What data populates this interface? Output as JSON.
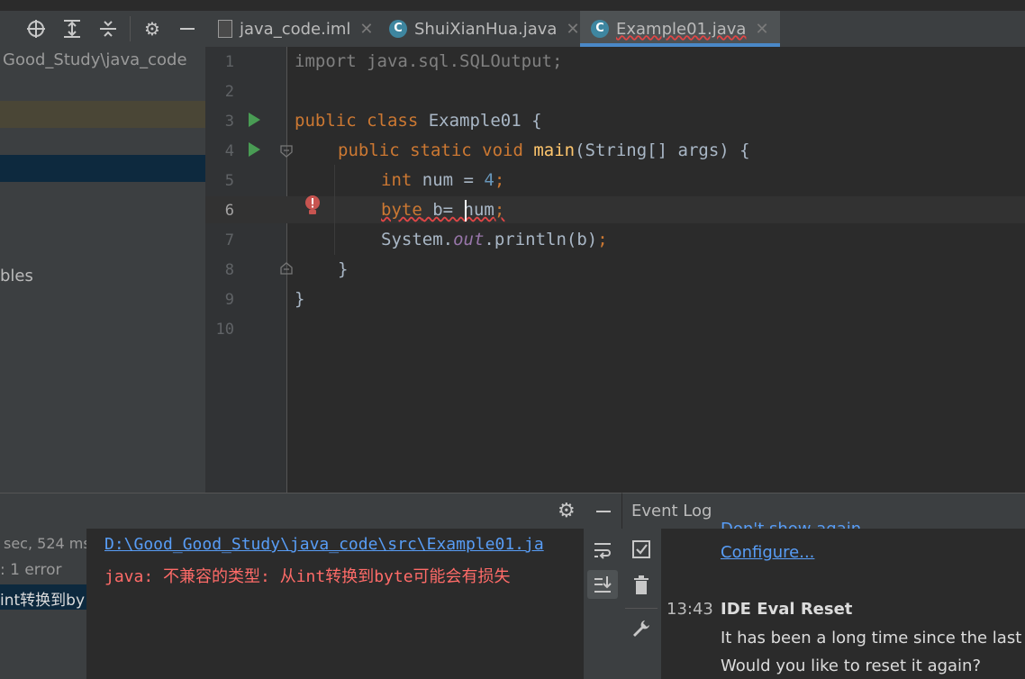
{
  "project_panel": {
    "path_fragment": "Good_Study\\java_code",
    "item_fragment": "bles"
  },
  "tabs": [
    {
      "label": "java_code.iml"
    },
    {
      "label": "ShuiXianHua.java"
    },
    {
      "label": "Example01.java"
    }
  ],
  "editor": {
    "line_numbers": [
      "1",
      "2",
      "3",
      "4",
      "5",
      "6",
      "7",
      "8",
      "9",
      "10"
    ],
    "lines": {
      "l1": "import java.sql.SQLOutput;",
      "l3_kw": "public class ",
      "l3_name": "Example01 {",
      "l4_kw": "public static void ",
      "l4_fn": "main",
      "l4_rest": "(String[] args) {",
      "l5_kw": "int",
      "l5_var": " num = ",
      "l5_num": "4",
      "l5_semi": ";",
      "l6_kw": "byte",
      "l6_rest": " b= num",
      "l6_semi": ";",
      "l7_a": "System.",
      "l7_out": "out",
      "l7_b": ".println(b)",
      "l7_semi": ";",
      "l8": "}",
      "l9": "}"
    }
  },
  "build": {
    "time_fragment": "sec, 524 ms",
    "error_fragment": ": 1 error",
    "msg_fragment": "int转换到by",
    "file_path": "D:\\Good_Good_Study\\java_code\\src\\Example01.ja",
    "error_line": "java: 不兼容的类型: 从int转换到byte可能会有损失"
  },
  "event_log": {
    "title": "Event Log",
    "link_partial": "Don't show again",
    "configure_link": "Configure...",
    "time": "13:43",
    "event_title": "IDE Eval Reset",
    "line1": "It has been a long time since the last res",
    "line2": "Would you like to reset it again?"
  },
  "icons": {
    "locate": "crosshair-icon",
    "expand": "expand-all-icon",
    "collapse": "collapse-all-icon",
    "settings": "gear-icon",
    "hide": "minimize-icon"
  }
}
